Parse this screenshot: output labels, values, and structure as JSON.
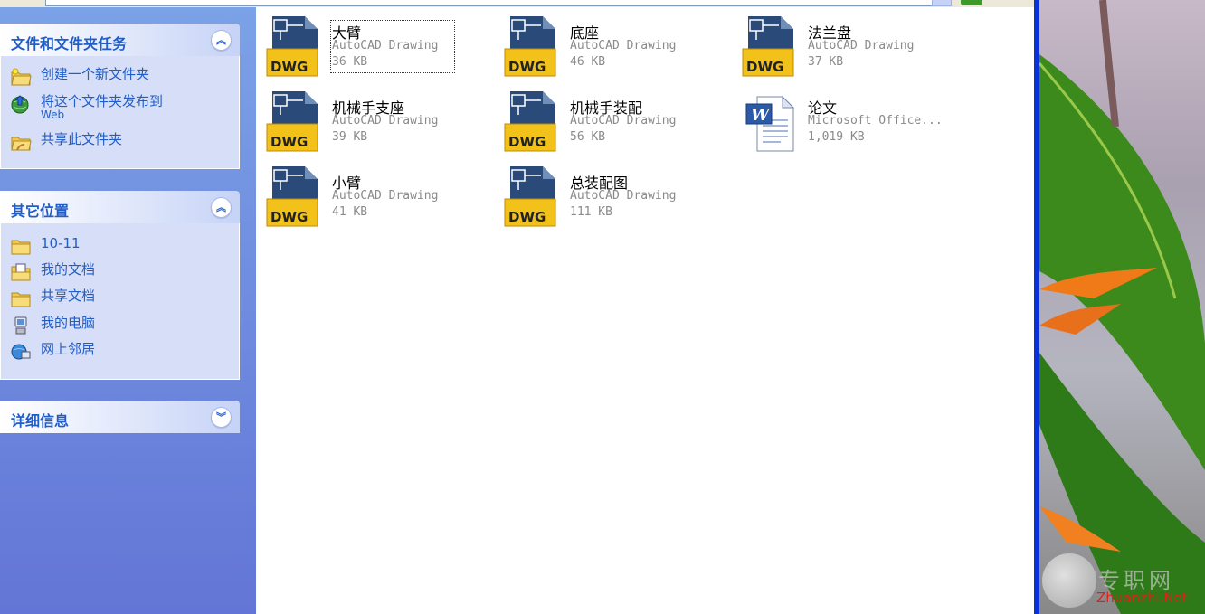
{
  "task_pane": {
    "groups": [
      {
        "title": "文件和文件夹任务",
        "items": [
          {
            "label": "创建一个新文件夹",
            "icon": "new-folder-icon"
          },
          {
            "label": "将这个文件夹发布到",
            "label2": "Web",
            "icon": "publish-web-icon"
          },
          {
            "label": "共享此文件夹",
            "icon": "share-folder-icon"
          }
        ]
      },
      {
        "title": "其它位置",
        "items": [
          {
            "label": "10-11",
            "icon": "folder-icon"
          },
          {
            "label": "我的文档",
            "icon": "my-documents-icon"
          },
          {
            "label": "共享文档",
            "icon": "shared-folder-icon"
          },
          {
            "label": "我的电脑",
            "icon": "my-computer-icon"
          },
          {
            "label": "网上邻居",
            "icon": "network-icon"
          }
        ]
      },
      {
        "title": "详细信息",
        "items": []
      }
    ]
  },
  "files": [
    {
      "name": "大臂",
      "type": "AutoCAD Drawing",
      "size": "36 KB",
      "icon": "dwg-file-icon",
      "selected": true
    },
    {
      "name": "底座",
      "type": "AutoCAD Drawing",
      "size": "46 KB",
      "icon": "dwg-file-icon"
    },
    {
      "name": "法兰盘",
      "type": "AutoCAD Drawing",
      "size": "37 KB",
      "icon": "dwg-file-icon"
    },
    {
      "name": "机械手支座",
      "type": "AutoCAD Drawing",
      "size": "39 KB",
      "icon": "dwg-file-icon"
    },
    {
      "name": "机械手装配",
      "type": "AutoCAD Drawing",
      "size": "56 KB",
      "icon": "dwg-file-icon"
    },
    {
      "name": "论文",
      "type": "Microsoft Office...",
      "size": "1,019 KB",
      "icon": "word-doc-icon"
    },
    {
      "name": "小臂",
      "type": "AutoCAD Drawing",
      "size": "41 KB",
      "icon": "dwg-file-icon"
    },
    {
      "name": "总装配图",
      "type": "AutoCAD Drawing",
      "size": "111 KB",
      "icon": "dwg-file-icon"
    }
  ],
  "dwg_badge": "DWG",
  "word_badge": "W",
  "watermark": {
    "cn": "专职网",
    "en": "Zhuanzhi.Net"
  },
  "colors": {
    "task_link": "#215dc6",
    "pane_top": "#7ba2e7",
    "pane_bottom": "#6375d6",
    "group_body": "#d6dff7"
  }
}
